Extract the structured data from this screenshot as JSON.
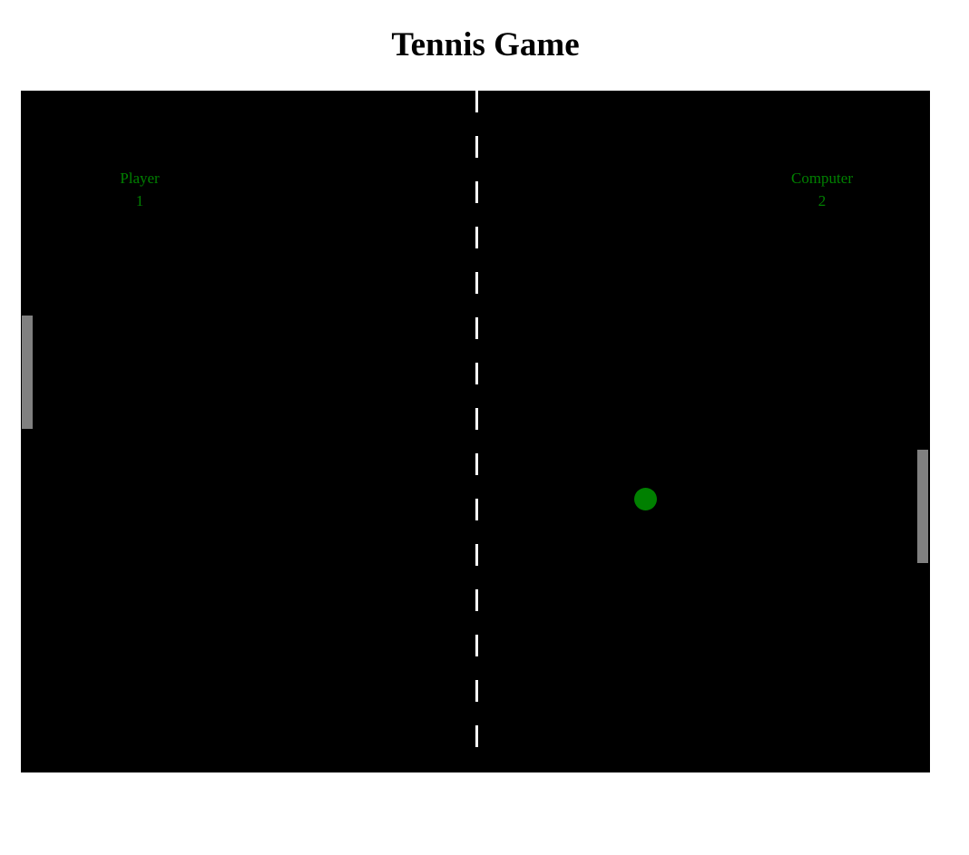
{
  "page": {
    "title": "Tennis Game"
  },
  "scoreboard": {
    "player": {
      "label": "Player",
      "score": "1"
    },
    "computer": {
      "label": "Computer",
      "score": "2"
    }
  },
  "colors": {
    "court": "#000000",
    "net": "#ffffff",
    "paddle": "#808080",
    "ball": "#008000",
    "score_text": "#008000"
  }
}
